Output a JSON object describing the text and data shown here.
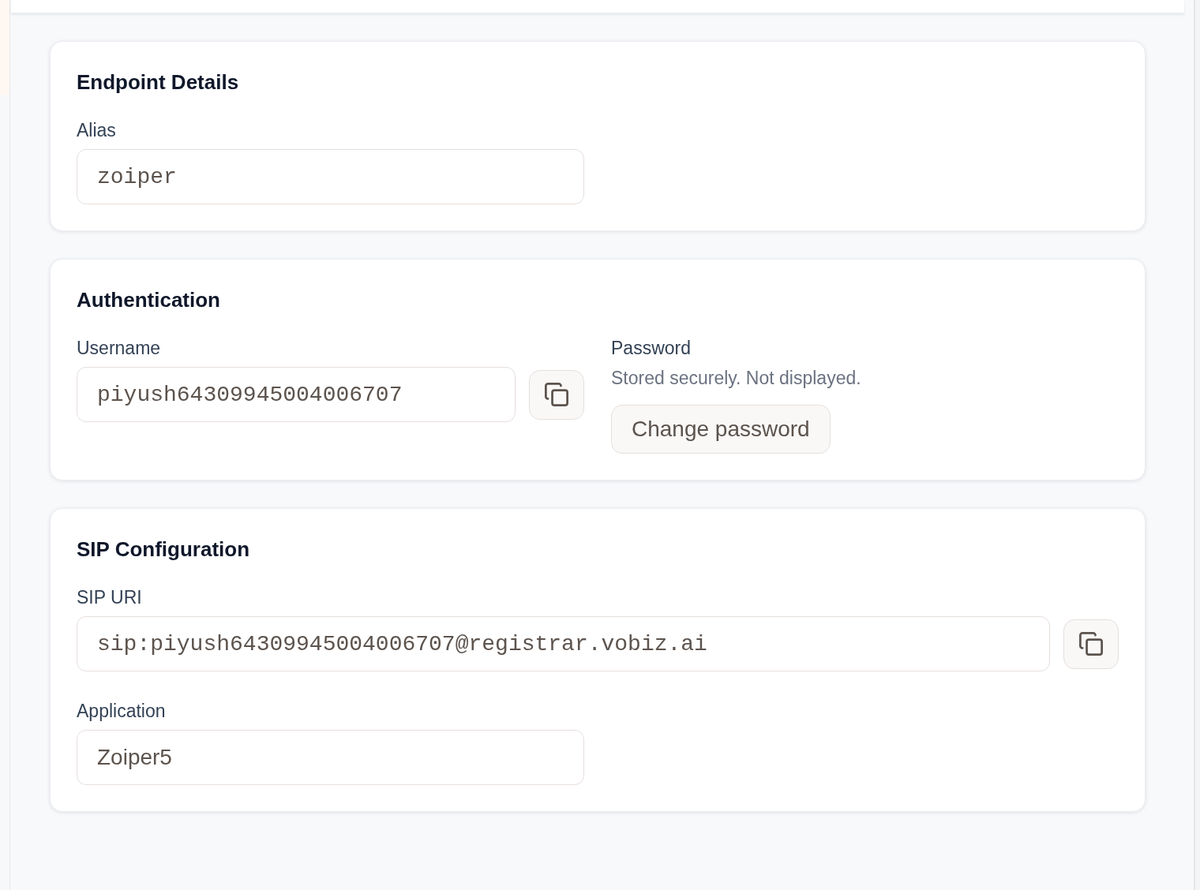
{
  "sections": [
    {
      "title": "Endpoint Details",
      "fields": [
        {
          "kind": "code",
          "label": "Alias",
          "value": "zoiper",
          "copyable": false
        }
      ]
    },
    {
      "title": "Authentication",
      "fields": [
        {
          "kind": "code",
          "label": "Username",
          "value": "piyush64309945004006707",
          "copyable": true
        },
        {
          "kind": "secret",
          "label": "Password",
          "note": "Stored securely. Not displayed.",
          "button": "Change password"
        }
      ]
    },
    {
      "title": "SIP Configuration",
      "fields": [
        {
          "kind": "uri",
          "label": "SIP URI",
          "value": "sip:piyush64309945004006707@registrar.vobiz.ai",
          "copyable": true
        },
        {
          "kind": "text",
          "label": "Application",
          "value": "Zoiper5",
          "copyable": false
        }
      ]
    }
  ]
}
